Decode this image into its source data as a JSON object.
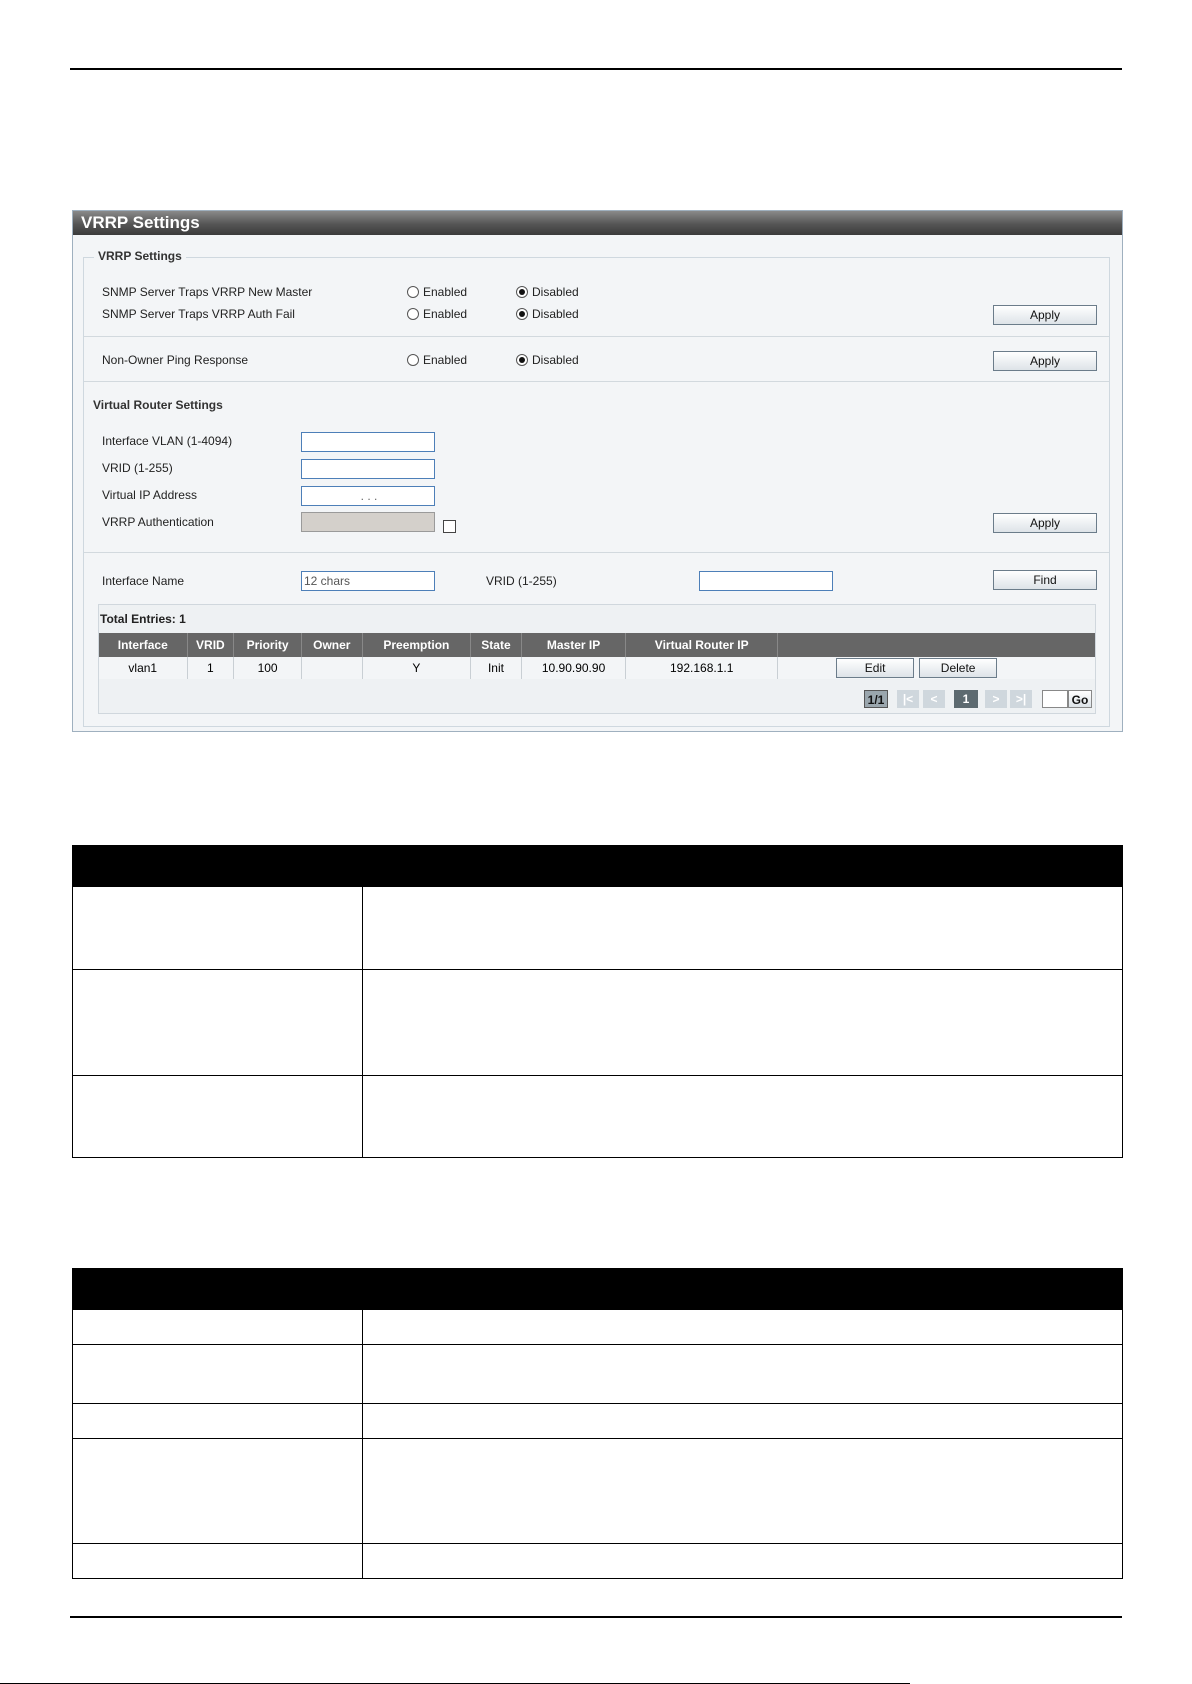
{
  "panel": {
    "title": "VRRP Settings",
    "legend": "VRRP Settings",
    "traps": [
      {
        "label": "SNMP Server Traps VRRP New Master",
        "enabled_label": "Enabled",
        "disabled_label": "Disabled",
        "selected": "Disabled"
      },
      {
        "label": "SNMP Server Traps VRRP Auth Fail",
        "enabled_label": "Enabled",
        "disabled_label": "Disabled",
        "selected": "Disabled"
      }
    ],
    "apply_label": "Apply",
    "ping": {
      "label": "Non-Owner Ping Response",
      "enabled_label": "Enabled",
      "disabled_label": "Disabled",
      "selected": "Disabled"
    },
    "vr_heading": "Virtual Router Settings",
    "vr_fields": {
      "vlan_label": "Interface VLAN (1-4094)",
      "vrid_label": "VRID (1-255)",
      "vip_label": "Virtual IP Address",
      "vip_value": ".      .      .",
      "auth_label": "VRRP Authentication"
    },
    "find": {
      "iface_label": "Interface Name",
      "iface_placeholder": "12 chars",
      "vrid_label": "VRID (1-255)",
      "button": "Find"
    },
    "table": {
      "total": "Total Entries: 1",
      "columns": [
        "Interface",
        "VRID",
        "Priority",
        "Owner",
        "Preemption",
        "State",
        "Master IP",
        "Virtual Router IP",
        ""
      ],
      "rows": [
        {
          "interface": "vlan1",
          "vrid": "1",
          "priority": "100",
          "owner": "",
          "preemption": "Y",
          "state": "Init",
          "master_ip": "10.90.90.90",
          "virtual_ip": "192.168.1.1"
        }
      ],
      "edit_label": "Edit",
      "delete_label": "Delete"
    },
    "pagination": {
      "page_info": "1/1",
      "first": "|<",
      "prev": "<",
      "current": "1",
      "next": ">",
      "last": ">|",
      "go_label": "Go"
    }
  },
  "colors": {
    "title_bar": "#4a4a4a",
    "panel_bg": "#f3f5f7",
    "table_header": "#666666",
    "doc_header": "#000000"
  }
}
